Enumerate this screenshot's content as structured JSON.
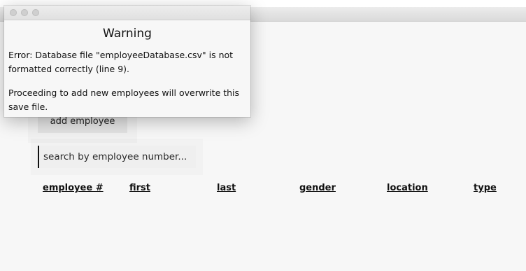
{
  "main_window": {
    "add_employee_label": "add employee",
    "search_placeholder": "search by employee number...",
    "columns": [
      {
        "label": "employee #"
      },
      {
        "label": "first"
      },
      {
        "label": "last"
      },
      {
        "label": "gender"
      },
      {
        "label": "location"
      },
      {
        "label": "type"
      }
    ]
  },
  "dialog": {
    "title": "Warning",
    "error_message": "Error: Database file \"employeeDatabase.csv\" is not formatted correctly (line 9).",
    "warning_message": "Proceeding to add new employees will overwrite this save file.",
    "window_controls": [
      {
        "icon": "close-icon"
      },
      {
        "icon": "minimize-icon"
      },
      {
        "icon": "maximize-icon"
      }
    ]
  },
  "colors": {
    "window_background": "#f7f7f7",
    "button_background": "#e3e3e3",
    "search_background": "#efefef",
    "traffic_light_inactive": "#cfcfcf"
  }
}
